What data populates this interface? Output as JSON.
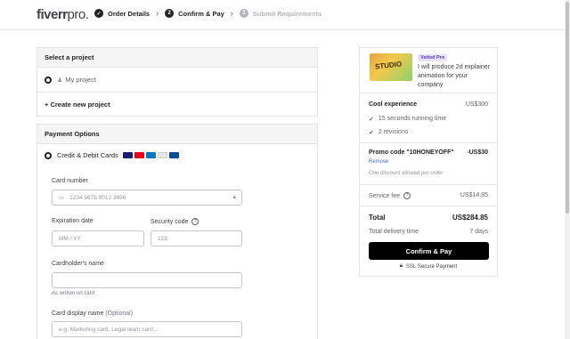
{
  "header": {
    "logo_main": "fiverr",
    "logo_sub": "pro.",
    "steps": [
      {
        "num": "✓",
        "label": "Order Details"
      },
      {
        "num": "2",
        "label": "Confirm & Pay"
      },
      {
        "num": "3",
        "label": "Submit Requirements"
      }
    ]
  },
  "project": {
    "heading": "Select a project",
    "selected": "My project",
    "create": "+ Create new project"
  },
  "payment": {
    "heading": "Payment Options",
    "method": "Credit & Debit Cards",
    "card_colors": [
      "#1a1f71",
      "#eb001b",
      "#0079be",
      "#e6e6e6",
      "#0e4c96"
    ],
    "card_number_label": "Card number",
    "card_number_placeholder": "1234 5678 9012 3456",
    "expiration_label": "Expiration date",
    "expiration_placeholder": "MM / YY",
    "security_label": "Security code",
    "security_placeholder": "123",
    "holder_label": "Cardholder's name",
    "holder_hint": "As written on card",
    "display_label": "Card display name",
    "display_optional": "(Optional)",
    "display_placeholder": "e.g. Marketing card, Legal team card..."
  },
  "summary": {
    "thumb_text": "STUDIO",
    "badge": "Vetted Pro",
    "gig_title": "I will produce 2d explainer animation for your company",
    "package": "Cool experience",
    "package_price": "US$300",
    "features": [
      "15 seconds running time",
      "2 revisions"
    ],
    "promo_label": "Promo code \"10HONEYOFF\"",
    "promo_value": "-US$30",
    "remove": "Remove",
    "promo_note": "One discount allowed per order",
    "service_fee_label": "Service fee",
    "service_fee": "US$14.85",
    "total_label": "Total",
    "total": "US$284.85",
    "delivery_label": "Total delivery time",
    "delivery": "7 days",
    "confirm": "Confirm & Pay",
    "ssl": "SSL Secure Payment"
  }
}
